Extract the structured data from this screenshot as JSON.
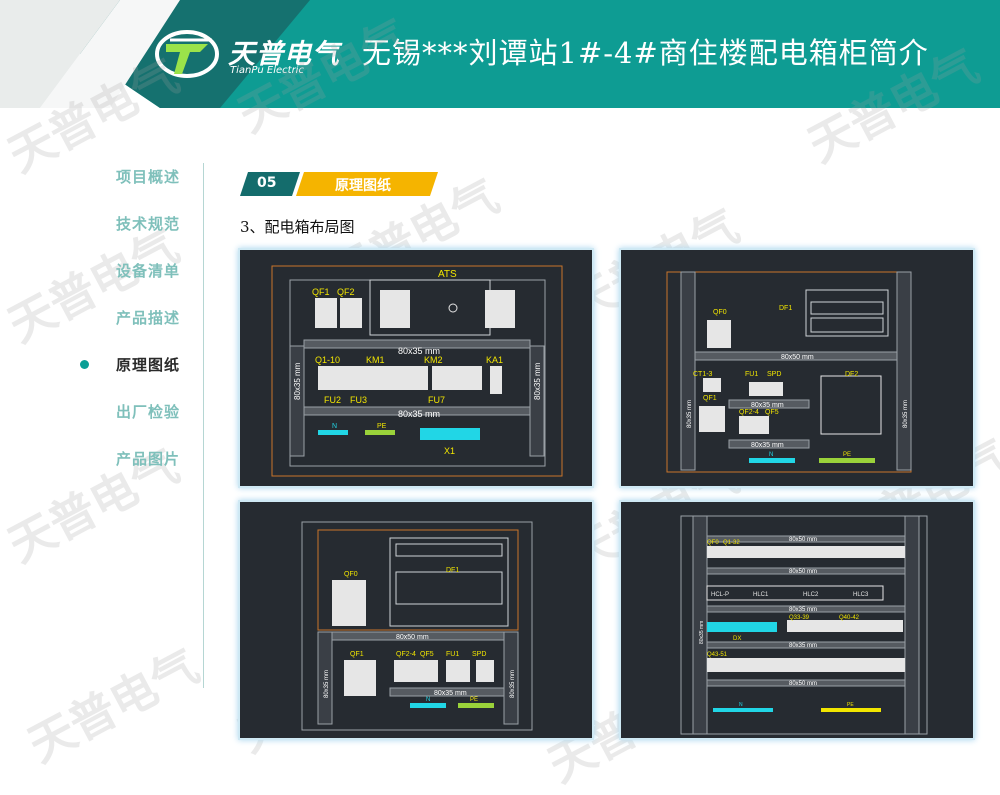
{
  "header": {
    "title": "无锡***刘谭站1#-4#商住楼配电箱柜简介",
    "logo_cn": "天普电气",
    "logo_en": "TianPu Electric"
  },
  "watermark": "天普电气",
  "nav": {
    "items": [
      {
        "label": "项目概述",
        "active": false
      },
      {
        "label": "技术规范",
        "active": false
      },
      {
        "label": "设备清单",
        "active": false
      },
      {
        "label": "产品描述",
        "active": false
      },
      {
        "label": "原理图纸",
        "active": true
      },
      {
        "label": "出厂检验",
        "active": false
      },
      {
        "label": "产品图片",
        "active": false
      }
    ]
  },
  "section": {
    "number": "05",
    "label": "原理图纸"
  },
  "subtitle": "3、配电箱布局图",
  "panel1": {
    "ats": "ATS",
    "qf1": "QF1",
    "qf2": "QF2",
    "rail_top": "80x35 mm",
    "rail_bottom": "80x35 mm",
    "side_left": "80x35 mm",
    "side_right": "80x35 mm",
    "q1_10": "Q1-10",
    "km1": "KM1",
    "km2": "KM2",
    "ka1": "KA1",
    "fu2": "FU2",
    "fu3": "FU3",
    "fu7": "FU7",
    "n": "N",
    "pe": "PE",
    "x1": "X1"
  },
  "panel2": {
    "qf0": "QF0",
    "df1": "DF1",
    "rail1": "80x50 mm",
    "ct": "CT1-3",
    "fu1": "FU1",
    "spd": "SPD",
    "qf1": "QF1",
    "df2": "DF2",
    "rail2": "80x35 mm",
    "qf24": "QF2-4",
    "qf5": "QF5",
    "rail3": "80x35 mm",
    "side_left": "80x35 mm",
    "side_right": "80x35 mm",
    "n": "N",
    "pe": "PE"
  },
  "panel3": {
    "qf0": "QF0",
    "df1": "DF1",
    "rail1": "80x50 mm",
    "qf1": "QF1",
    "qf24": "QF2-4",
    "qf5": "QF5",
    "fu1": "FU1",
    "spd": "SPD",
    "rail2": "80x35 mm",
    "side_left": "80x35 mm",
    "side_right": "80x35 mm",
    "n": "N",
    "pe": "PE"
  },
  "panel4": {
    "qf0": "QF0",
    "q1_32": "Q1-32",
    "rail1": "80x50 mm",
    "rail2": "80x50 mm",
    "hcl_p": "HCL-P",
    "hlc1": "HLC1",
    "hlc2": "HLC2",
    "hlc3": "HLC3",
    "rail3": "80x35 mm",
    "q33_39": "Q33-39",
    "q40_42": "Q40-42",
    "dx": "DX",
    "rail4": "80x35 mm",
    "q43_51": "Q43-51",
    "rail5": "80x50 mm",
    "side": "80x35 mm",
    "n": "N",
    "pe": "PE"
  },
  "colors": {
    "teal": "#0a9c93",
    "dark_teal": "#146c6c",
    "orange": "#f5b400",
    "panel_bg": "#262b31",
    "cad_yellow": "#f2e600",
    "cad_orange": "#c9762a",
    "cad_cyan": "#21d6e6",
    "cad_green": "#9ad23a"
  }
}
